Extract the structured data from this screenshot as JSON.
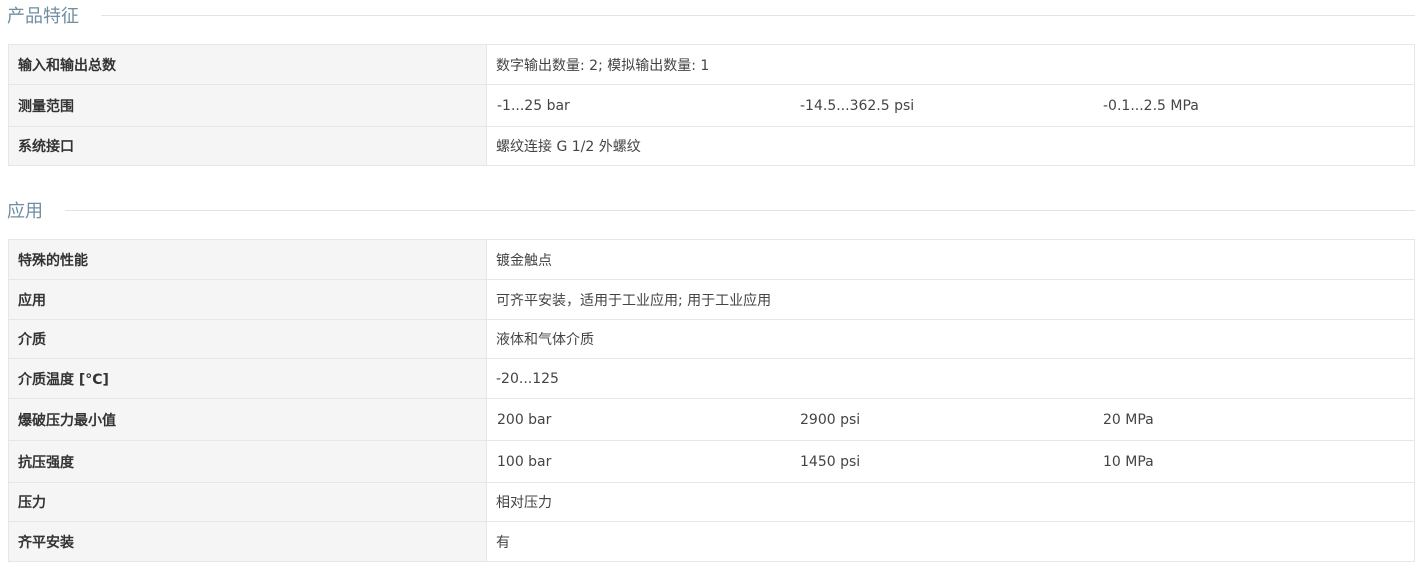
{
  "sections": [
    {
      "title": "产品特征",
      "rows": [
        {
          "label": "输入和输出总数",
          "values": [
            "数字输出数量: 2; 模拟输出数量: 1"
          ]
        },
        {
          "label": "测量范围",
          "values": [
            "-1...25 bar",
            "-14.5...362.5 psi",
            "-0.1...2.5 MPa"
          ]
        },
        {
          "label": "系统接口",
          "values": [
            "螺纹连接 G 1/2 外螺纹"
          ]
        }
      ]
    },
    {
      "title": "应用",
      "rows": [
        {
          "label": "特殊的性能",
          "values": [
            "镀金触点"
          ]
        },
        {
          "label": "应用",
          "values": [
            "可齐平安装，适用于工业应用; 用于工业应用"
          ]
        },
        {
          "label": "介质",
          "values": [
            "液体和气体介质"
          ]
        },
        {
          "label": "介质温度 [°C]",
          "values": [
            "-20...125"
          ]
        },
        {
          "label": "爆破压力最小值",
          "values": [
            "200 bar",
            "2900 psi",
            "20 MPa"
          ]
        },
        {
          "label": "抗压强度",
          "values": [
            "100 bar",
            "1450 psi",
            "10 MPa"
          ]
        },
        {
          "label": "压力",
          "values": [
            "相对压力"
          ]
        },
        {
          "label": "齐平安装",
          "values": [
            "有"
          ]
        }
      ]
    }
  ]
}
